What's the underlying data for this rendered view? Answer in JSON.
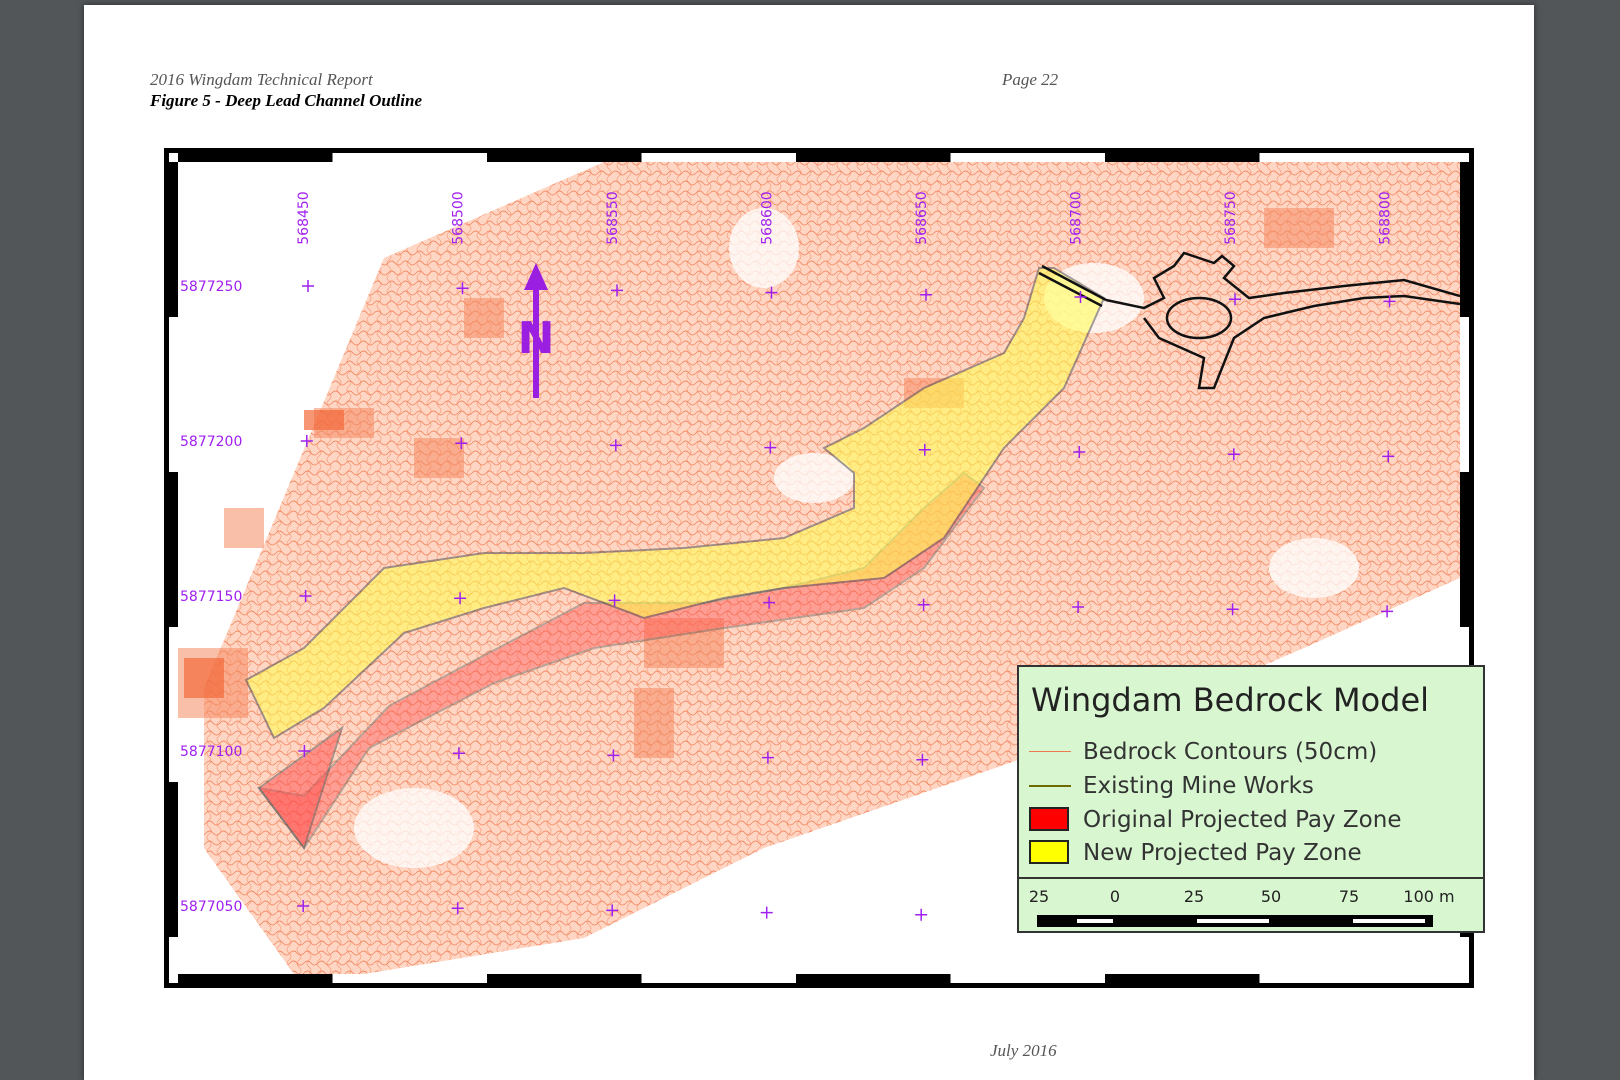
{
  "header": {
    "report_title": "2016 Wingdam Technical Report",
    "figure_caption": "Figure 5 - Deep Lead Channel Outline",
    "page_number": "Page 22"
  },
  "footer": {
    "date": "July 2016"
  },
  "map": {
    "easting_labels": [
      "568450",
      "568500",
      "568550",
      "568600",
      "568650",
      "568700",
      "568750",
      "568800"
    ],
    "northing_labels": [
      "5877250",
      "5877200",
      "5877150",
      "5877100",
      "5877050"
    ],
    "north_arrow_label": "N",
    "colors": {
      "contour": "#f07a50",
      "grid_label": "#a020f0",
      "mine_works": "#111111",
      "original_pay_zone": "#ff0000",
      "new_pay_zone": "#ffff00"
    }
  },
  "legend": {
    "title": "Wingdam Bedrock Model",
    "items": [
      {
        "label": "Bedrock Contours (50cm)",
        "symbol": "line",
        "color": "#f07a50"
      },
      {
        "label": "Existing Mine Works",
        "symbol": "line",
        "color": "#6b6b00"
      },
      {
        "label": "Original Projected Pay Zone",
        "symbol": "box",
        "color": "#ff0000"
      },
      {
        "label": "New Projected Pay Zone",
        "symbol": "box",
        "color": "#ffff00"
      }
    ],
    "scale": {
      "labels": [
        "25",
        "0",
        "25",
        "50",
        "75",
        "100 m"
      ]
    }
  }
}
